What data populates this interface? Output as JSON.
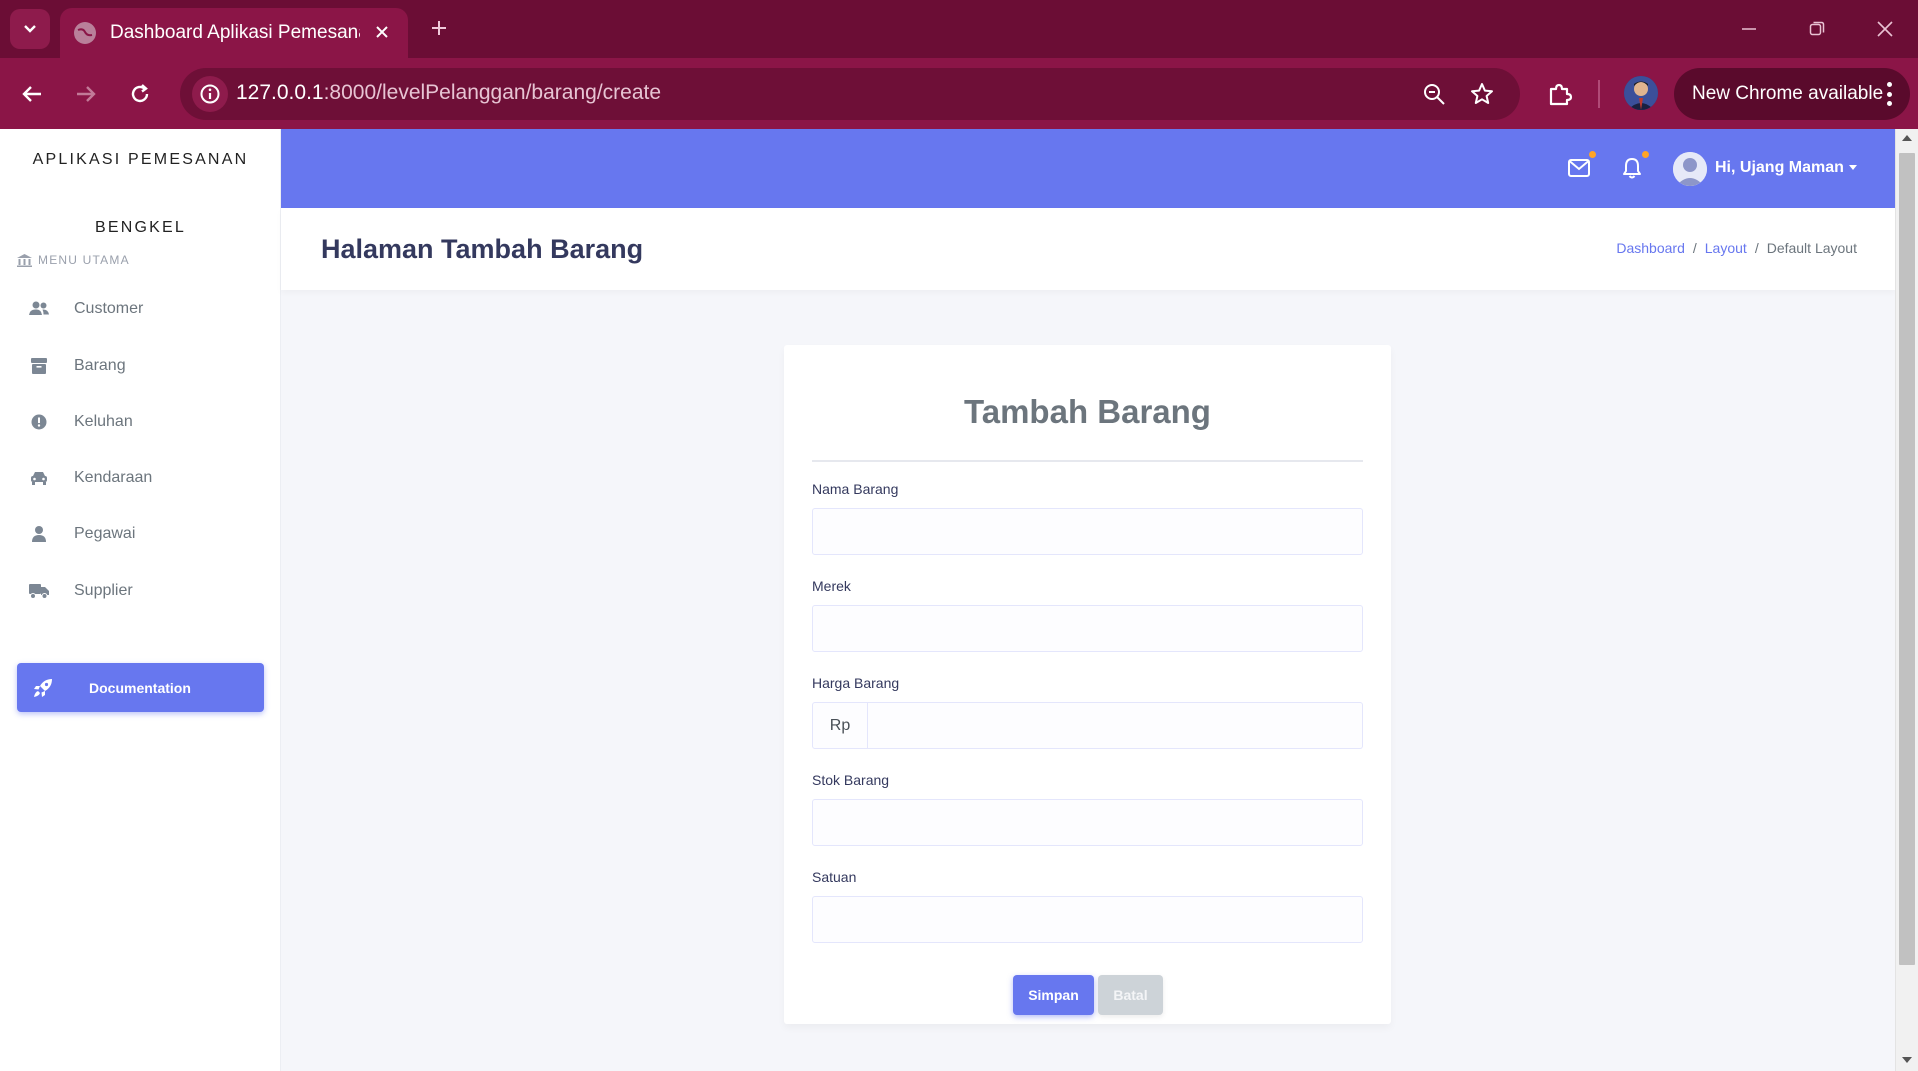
{
  "browser": {
    "tab_title": "Dashboard Aplikasi Pemesanan",
    "url_host": "127.0.0.1",
    "url_rest": ":8000/levelPelanggan/barang/create",
    "update_label": "New Chrome available"
  },
  "sidebar": {
    "brand_line1": "APLIKASI PEMESANAN",
    "brand_line2": "BENGKEL",
    "menu_header": "MENU UTAMA",
    "items": [
      {
        "label": "Customer",
        "icon": "users-icon"
      },
      {
        "label": "Barang",
        "icon": "box-icon"
      },
      {
        "label": "Keluhan",
        "icon": "exclamation-icon"
      },
      {
        "label": "Kendaraan",
        "icon": "car-icon"
      },
      {
        "label": "Pegawai",
        "icon": "user-icon"
      },
      {
        "label": "Supplier",
        "icon": "truck-icon"
      }
    ],
    "doc_button": "Documentation"
  },
  "topbar": {
    "user_greeting": "Hi, Ujang Maman",
    "accent": "#6777ef"
  },
  "header": {
    "title": "Halaman Tambah Barang",
    "breadcrumb": [
      "Dashboard",
      "Layout",
      "Default Layout"
    ]
  },
  "form": {
    "title": "Tambah Barang",
    "fields": [
      {
        "label": "Nama Barang",
        "value": ""
      },
      {
        "label": "Merek",
        "value": ""
      },
      {
        "label": "Harga Barang",
        "value": "",
        "prefix": "Rp"
      },
      {
        "label": "Stok Barang",
        "value": ""
      },
      {
        "label": "Satuan",
        "value": ""
      }
    ],
    "save_label": "Simpan",
    "cancel_label": "Batal"
  }
}
